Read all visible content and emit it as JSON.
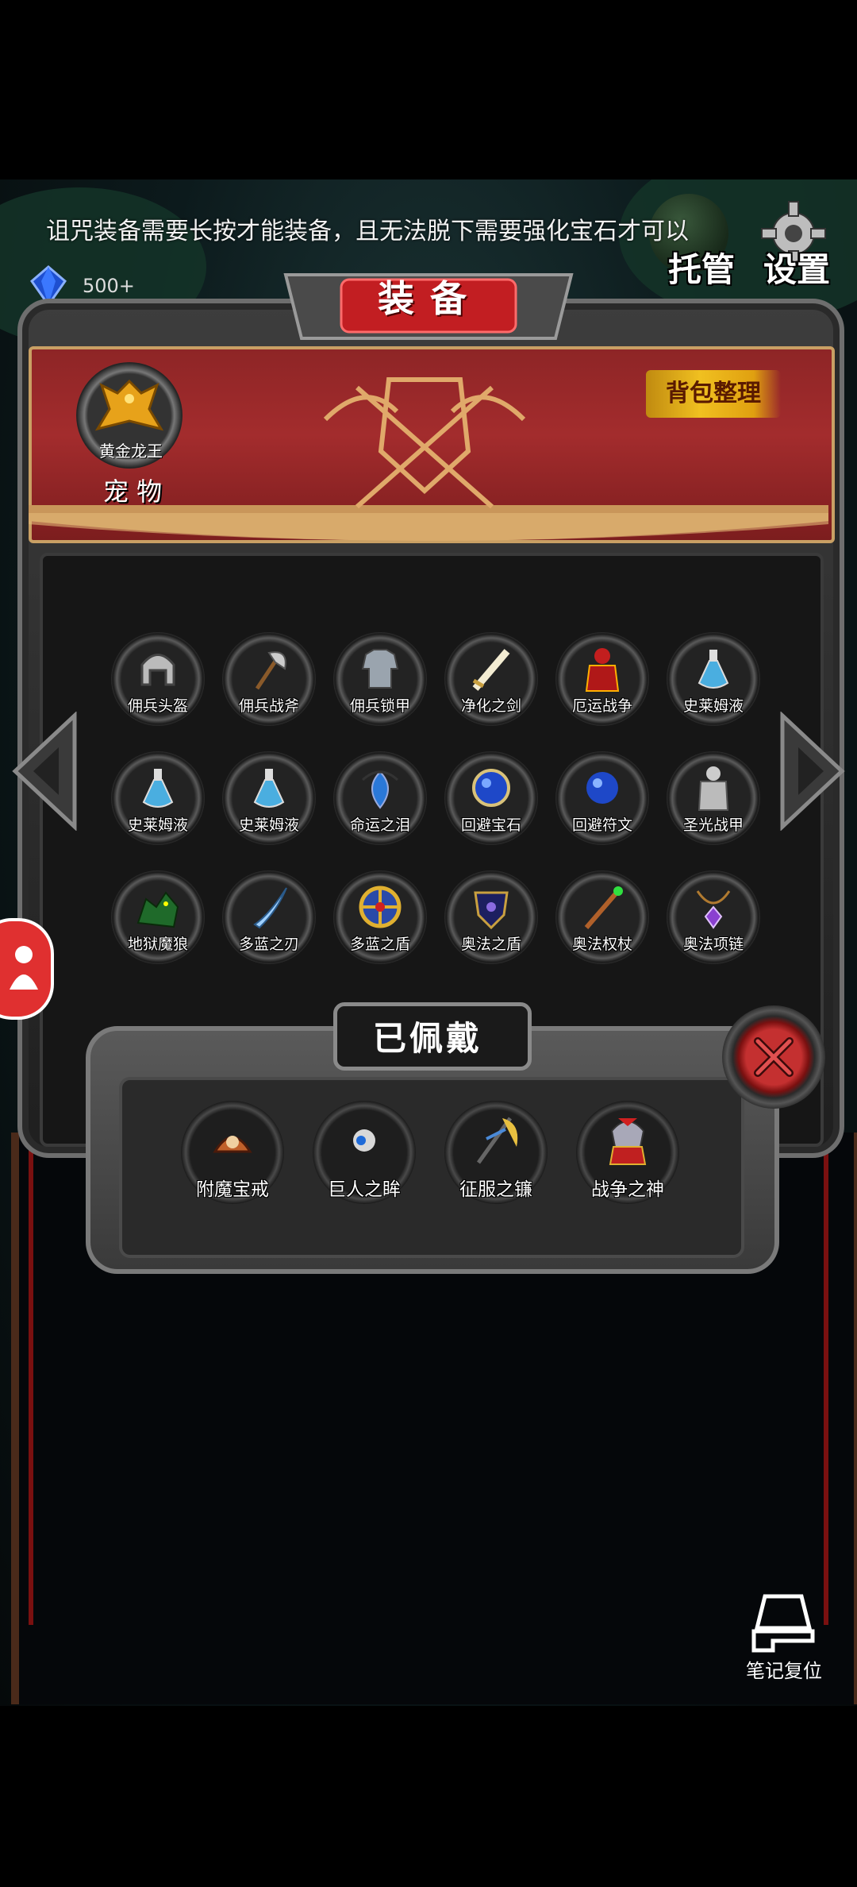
{
  "tip_text": "诅咒装备需要长按才能装备，且无法脱下需要强化宝石才可以",
  "gem_count": "500+",
  "top_buttons": {
    "auto": "托管",
    "settings": "设置"
  },
  "title": "装备",
  "sort_button": "背包整理",
  "pet": {
    "name": "黄金龙王",
    "label": "宠 物"
  },
  "inventory": [
    {
      "label": "佣兵头盔",
      "icon": "helmet-icon"
    },
    {
      "label": "佣兵战斧",
      "icon": "axe-icon"
    },
    {
      "label": "佣兵锁甲",
      "icon": "chainmail-icon"
    },
    {
      "label": "净化之剑",
      "icon": "sword-icon"
    },
    {
      "label": "厄运战争",
      "icon": "red-knight-icon"
    },
    {
      "label": "史莱姆液",
      "icon": "potion-icon"
    },
    {
      "label": "史莱姆液",
      "icon": "potion-icon"
    },
    {
      "label": "史莱姆液",
      "icon": "potion-icon"
    },
    {
      "label": "命运之泪",
      "icon": "tear-amulet-icon"
    },
    {
      "label": "回避宝石",
      "icon": "blue-gem-icon"
    },
    {
      "label": "回避符文",
      "icon": "blue-rune-icon"
    },
    {
      "label": "圣光战甲",
      "icon": "armor-icon"
    },
    {
      "label": "地狱魔狼",
      "icon": "wolf-icon"
    },
    {
      "label": "多蓝之刃",
      "icon": "blade-icon"
    },
    {
      "label": "多蓝之盾",
      "icon": "round-shield-icon"
    },
    {
      "label": "奥法之盾",
      "icon": "arcane-shield-icon"
    },
    {
      "label": "奥法权杖",
      "icon": "staff-icon"
    },
    {
      "label": "奥法项链",
      "icon": "necklace-icon"
    }
  ],
  "worn": {
    "title": "已佩戴",
    "items": [
      {
        "label": "附魔宝戒",
        "icon": "ring-icon"
      },
      {
        "label": "巨人之眸",
        "icon": "eye-icon"
      },
      {
        "label": "征服之镰",
        "icon": "scythe-icon"
      },
      {
        "label": "战争之神",
        "icon": "war-god-icon"
      }
    ]
  },
  "reset_label": "笔记复位",
  "colors": {
    "banner_red": "#a32c2d",
    "gold": "#f0c020",
    "close_red": "#c43030",
    "frame_gray": "#3d3d3d"
  }
}
